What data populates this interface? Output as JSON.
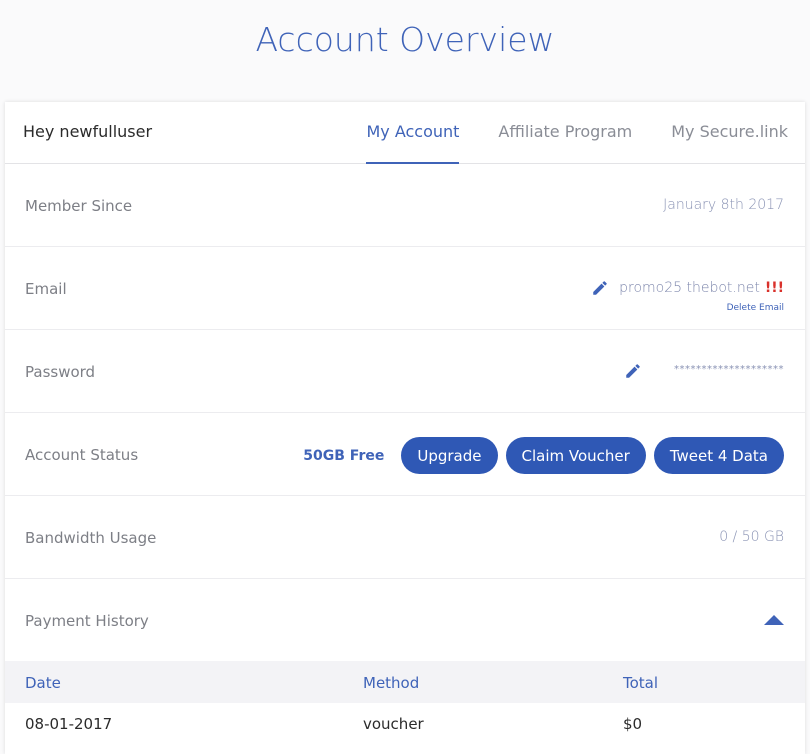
{
  "page": {
    "title": "Account Overview"
  },
  "header": {
    "greeting": "Hey newfulluser",
    "tabs": [
      {
        "label": "My Account",
        "active": true
      },
      {
        "label": "Affiliate Program",
        "active": false
      },
      {
        "label": "My Secure.link",
        "active": false
      }
    ]
  },
  "rows": {
    "member_since": {
      "label": "Member Since",
      "value": "January 8th 2017"
    },
    "email": {
      "label": "Email",
      "value": "promo25 thebot.net",
      "warning": "!!!",
      "delete_label": "Delete Email",
      "edit_icon": "pencil-icon"
    },
    "password": {
      "label": "Password",
      "value": "********************",
      "edit_icon": "pencil-icon"
    },
    "account_status": {
      "label": "Account Status",
      "plan": "50GB Free",
      "buttons": {
        "upgrade": "Upgrade",
        "claim_voucher": "Claim Voucher",
        "tweet": "Tweet 4 Data"
      }
    },
    "bandwidth": {
      "label": "Bandwidth Usage",
      "value": "0 / 50 GB"
    },
    "payment_history": {
      "label": "Payment History",
      "toggle_icon": "caret-up-icon"
    }
  },
  "payments": {
    "columns": {
      "date": "Date",
      "method": "Method",
      "total": "Total"
    },
    "rows": [
      {
        "date": "08-01-2017",
        "method": "voucher",
        "total": "$0"
      }
    ]
  },
  "colors": {
    "accent": "#3f63b8",
    "button": "#2f58b5",
    "warning": "#d9312b"
  }
}
